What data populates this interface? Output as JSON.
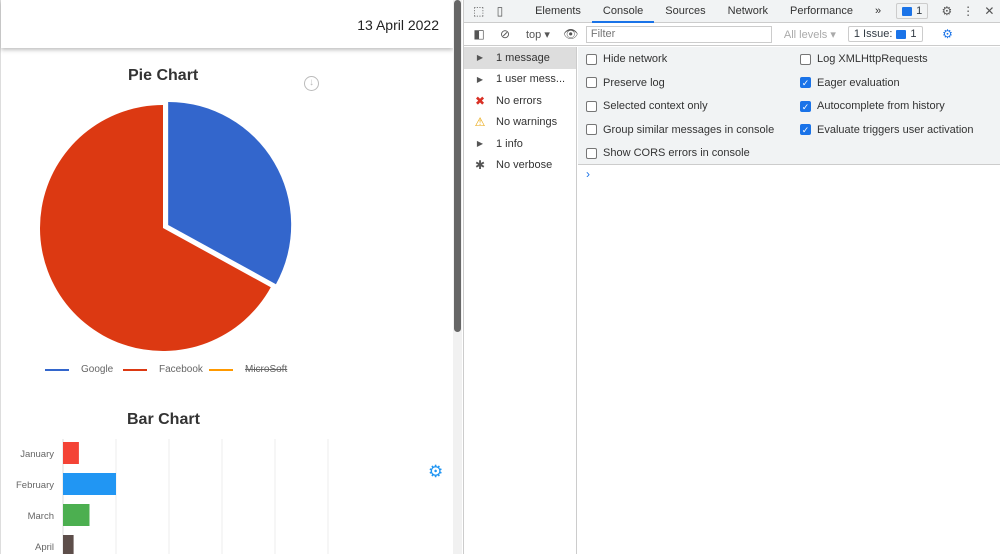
{
  "page": {
    "date": "13 April 2022"
  },
  "chart_data": [
    {
      "type": "pie",
      "title": "Pie Chart",
      "labels": [
        "Google",
        "Facebook",
        "MicroSoft"
      ],
      "values": [
        33,
        67,
        0
      ],
      "colors": [
        "#3366cc",
        "#dc3912",
        "#ff9900"
      ],
      "hidden": [
        "MicroSoft"
      ],
      "legend": "bottom"
    },
    {
      "type": "bar",
      "title": "Bar Chart",
      "orientation": "horizontal",
      "categories": [
        "January",
        "February",
        "March",
        "April"
      ],
      "values": [
        3,
        10,
        5,
        2
      ],
      "colors": [
        "#f44336",
        "#2196f3",
        "#4caf50",
        "#5d4e4a"
      ],
      "xlim": [
        0,
        50
      ],
      "grid": true
    }
  ],
  "devtools": {
    "tabs": [
      "Elements",
      "Console",
      "Sources",
      "Network",
      "Performance"
    ],
    "more": "»",
    "msg_count": "1",
    "context": "top ▾",
    "filter_placeholder": "Filter",
    "levels": "All levels ▾",
    "issues": "1 Issue:",
    "issue_count": "1",
    "sidebar": [
      {
        "label": "1 message",
        "icon": "▶"
      },
      {
        "label": "1 user mess...",
        "icon": "▶"
      },
      {
        "label": "No errors",
        "icon": "✖"
      },
      {
        "label": "No warnings",
        "icon": "⚠"
      },
      {
        "label": "1 info",
        "icon": "▶"
      },
      {
        "label": "No verbose",
        "icon": "✱"
      }
    ],
    "options_left": [
      {
        "label": "Hide network",
        "checked": false
      },
      {
        "label": "Preserve log",
        "checked": false
      },
      {
        "label": "Selected context only",
        "checked": false
      },
      {
        "label": "Group similar messages in console",
        "checked": false
      },
      {
        "label": "Show CORS errors in console",
        "checked": false
      }
    ],
    "options_right": [
      {
        "label": "Log XMLHttpRequests",
        "checked": false
      },
      {
        "label": "Eager evaluation",
        "checked": true
      },
      {
        "label": "Autocomplete from history",
        "checked": true
      },
      {
        "label": "Evaluate triggers user activation",
        "checked": true
      }
    ],
    "prompt": "›"
  }
}
